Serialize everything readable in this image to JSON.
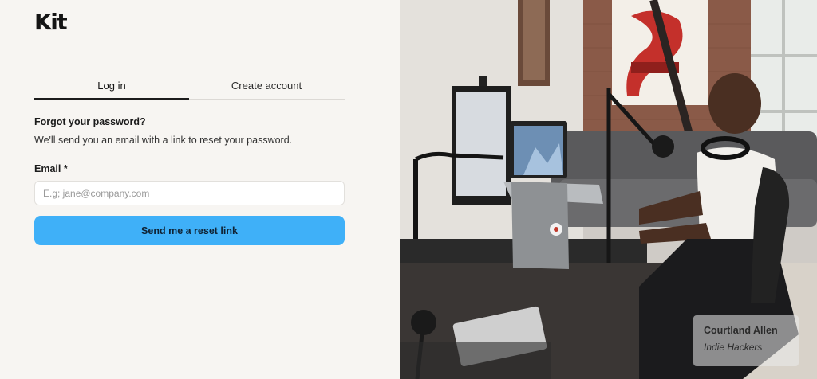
{
  "brand": {
    "logo_text": "Kit"
  },
  "tabs": [
    {
      "label": "Log in",
      "active": true
    },
    {
      "label": "Create account",
      "active": false
    }
  ],
  "form": {
    "title": "Forgot your password?",
    "description": "We'll send you an email with a link to reset your password.",
    "email_label": "Email *",
    "email_placeholder": "E.g; jane@company.com",
    "email_value": "",
    "submit_label": "Send me a reset link"
  },
  "testimonial": {
    "name": "Courtland Allen",
    "organization": "Indie Hackers"
  },
  "colors": {
    "background": "#f7f5f2",
    "primary_button": "#3fb0f8",
    "text": "#1c1c1c"
  }
}
